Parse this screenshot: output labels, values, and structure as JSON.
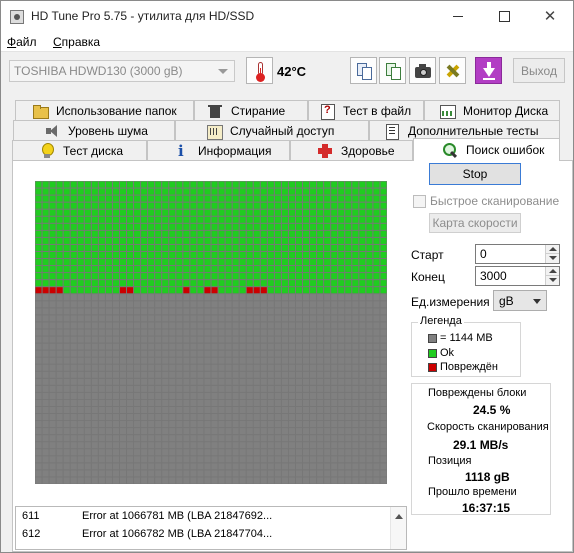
{
  "window": {
    "title": "HD Tune Pro 5.75 - утилита для HD/SSD"
  },
  "menu": {
    "file": {
      "mnemonic": "Ф",
      "rest": "айл"
    },
    "help": {
      "mnemonic": "С",
      "rest": "правка"
    }
  },
  "toolbar": {
    "drive": "TOSHIBA HDWD130 (3000 gB)",
    "temperature": "42°C",
    "exit_label": "Выход",
    "icons": [
      "copy-info-icon",
      "copy-screen-icon",
      "camera-icon",
      "tools-icon",
      "download-icon"
    ]
  },
  "tabs": {
    "row1": [
      "Использование папок",
      "Стирание",
      "Тест в файл",
      "Монитор Диска"
    ],
    "row2": [
      "Уровень шума",
      "Случайный доступ",
      "Дополнительные  тесты"
    ],
    "row3": [
      "Тест диска",
      "Информация",
      "Здоровье",
      "Поиск ошибок"
    ],
    "active": "Поиск ошибок"
  },
  "scan": {
    "stop_label": "Stop",
    "quick_scan_label": "Быстрое сканирование",
    "quick_scan_checked": false,
    "speed_map_label": "Карта скорости",
    "start_label": "Старт",
    "start_value": "0",
    "end_label": "Конец",
    "end_value": "3000",
    "unit_label": "Ед.измерения",
    "unit_value": "gB"
  },
  "legend": {
    "title": "Легенда",
    "block": "= 1144 MB",
    "ok": "Ok",
    "damaged": "Повреждён",
    "colors": {
      "unscanned": "#808080",
      "ok": "#20cc20",
      "damaged": "#cc0000"
    }
  },
  "stats": {
    "damaged_label": "Повреждены блоки",
    "damaged_value": "24.5 %",
    "speed_label": "Скорость сканирования",
    "speed_value": "29.1 MB/s",
    "position_label": "Позиция",
    "position_value": "1118 gB",
    "elapsed_label": "Прошло времени",
    "elapsed_value": "16:37:15"
  },
  "block_map": {
    "columns": 50,
    "rows": 43,
    "ok_rows": 15,
    "damaged_row": 15,
    "damaged_columns": [
      0,
      1,
      2,
      3,
      12,
      13,
      21,
      24,
      25,
      30,
      31,
      32
    ]
  },
  "log": [
    {
      "index": "611",
      "text": "Error at 1066781 MB (LBA 21847692..."
    },
    {
      "index": "612",
      "text": "Error at 1066782 MB (LBA 21847704..."
    }
  ]
}
